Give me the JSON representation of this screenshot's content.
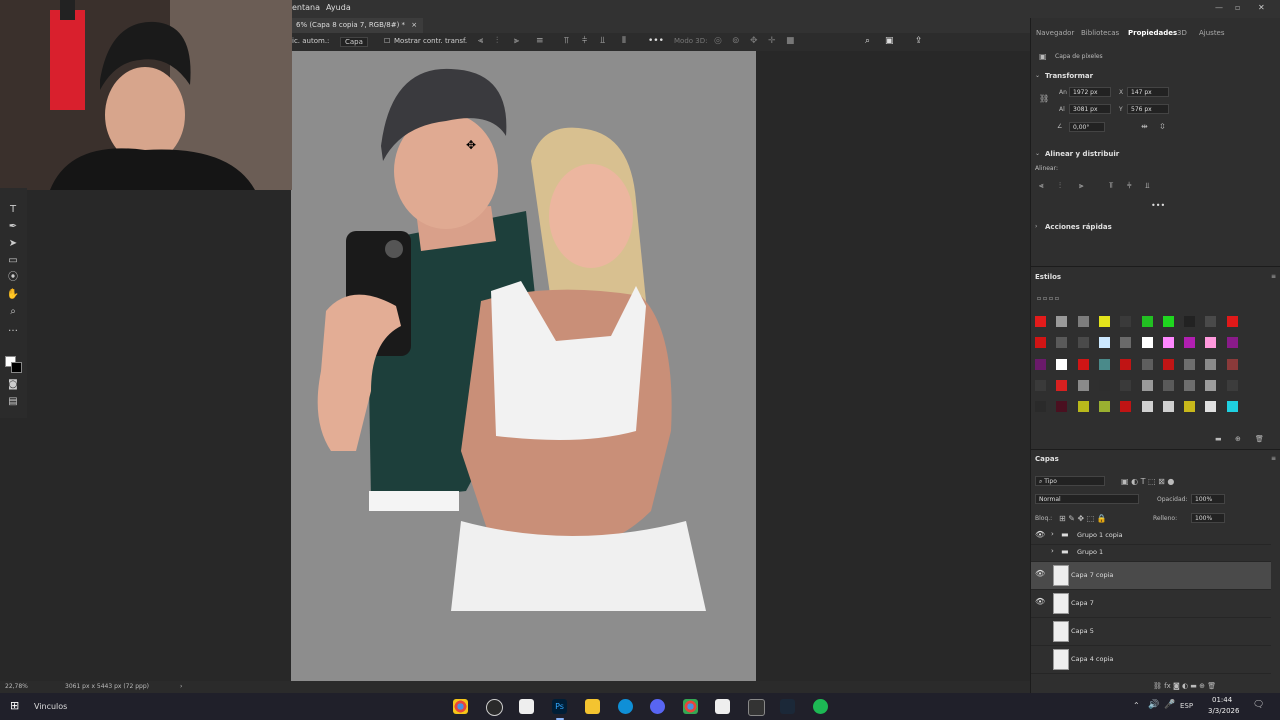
{
  "menubar": {
    "items": [
      "entana",
      "Ayuda"
    ]
  },
  "document_tab": {
    "label": "6% (Capa 8 copia 7, RGB/8#) *",
    "close": "×"
  },
  "options_bar": {
    "auto_select_label": "ic. autom.:",
    "auto_select_value": "Capa",
    "show_transform_label": "Mostrar contr. transf.",
    "mode_3d_label": "Modo 3D:",
    "more": "•••"
  },
  "status_bar": {
    "zoom": "22,78%",
    "doc_size": "3061 px x 5443 px (72 ppp)"
  },
  "panel_tabs": [
    "Navegador",
    "Bibliotecas",
    "Propiedades",
    "3D",
    "Ajustes"
  ],
  "properties": {
    "pixel_layer_label": "Capa de píxeles",
    "transform_title": "Transformar",
    "an_label": "An",
    "an_value": "1972 px",
    "x_label": "X",
    "x_value": "147 px",
    "al_label": "Al",
    "al_value": "3081 px",
    "y_label": "Y",
    "y_value": "576 px",
    "angle_value": "0,00°",
    "align_title": "Alinear y distribuir",
    "align_label": "Alinear:",
    "more": "•••",
    "quick_actions_title": "Acciones rápidas"
  },
  "styles": {
    "title": "Estilos",
    "swatch_colors": [
      "#e31b1b",
      "#9a9a9a",
      "#7d7d7d",
      "#e3e31b",
      "#3a3a3a",
      "#22c022",
      "#1fd61f",
      "#222222",
      "#4a4a4a",
      "#e01919",
      "#d11414",
      "#5a5a5a",
      "#4a4a4a",
      "#cce8ff",
      "#6a6a6a",
      "#ffffff",
      "#ff88ff",
      "#b11fb1",
      "#ff99dd",
      "#8a1b8a",
      "#6a1a6a",
      "#ffffff",
      "#d01515",
      "#4a8a8a",
      "#c01414",
      "#5e5e5e",
      "#c01515",
      "#6e6e6e",
      "#8a8a8a",
      "#8a3a3a",
      "#3a3a3a",
      "#d82020",
      "#8a8a8a",
      "#2e2e2e",
      "#3a3a3a",
      "#9a9a9a",
      "#5a5a5a",
      "#6e6e6e",
      "#9c9c9c",
      "#3c3c3c",
      "#2a2a2a",
      "#4a1020",
      "#b8b81b",
      "#9ab030",
      "#c01414",
      "#d0d0d0",
      "#cfcfcf",
      "#c8b81b",
      "#e0e0e0",
      "#1fd0e0"
    ]
  },
  "layers": {
    "title": "Capas",
    "filter_label": "Tipo",
    "blend_mode": "Normal",
    "opacity_label": "Opacidad:",
    "opacity_value": "100%",
    "lock_label": "Bloq.:",
    "fill_label": "Relleno:",
    "fill_value": "100%",
    "items": [
      {
        "name": "Grupo 1 copia",
        "visible": true,
        "type": "group"
      },
      {
        "name": "Grupo 1",
        "visible": false,
        "type": "group"
      },
      {
        "name": "Capa 7 copia",
        "visible": true,
        "type": "layer",
        "selected": true
      },
      {
        "name": "Capa 7",
        "visible": true,
        "type": "layer"
      },
      {
        "name": "Capa 5",
        "visible": false,
        "type": "layer"
      },
      {
        "name": "Capa 4 copia",
        "visible": false,
        "type": "layer"
      }
    ]
  },
  "taskbar": {
    "app_label": "Vinculos",
    "lang": "ESP",
    "time": "01:44",
    "date": "3/3/2026"
  }
}
